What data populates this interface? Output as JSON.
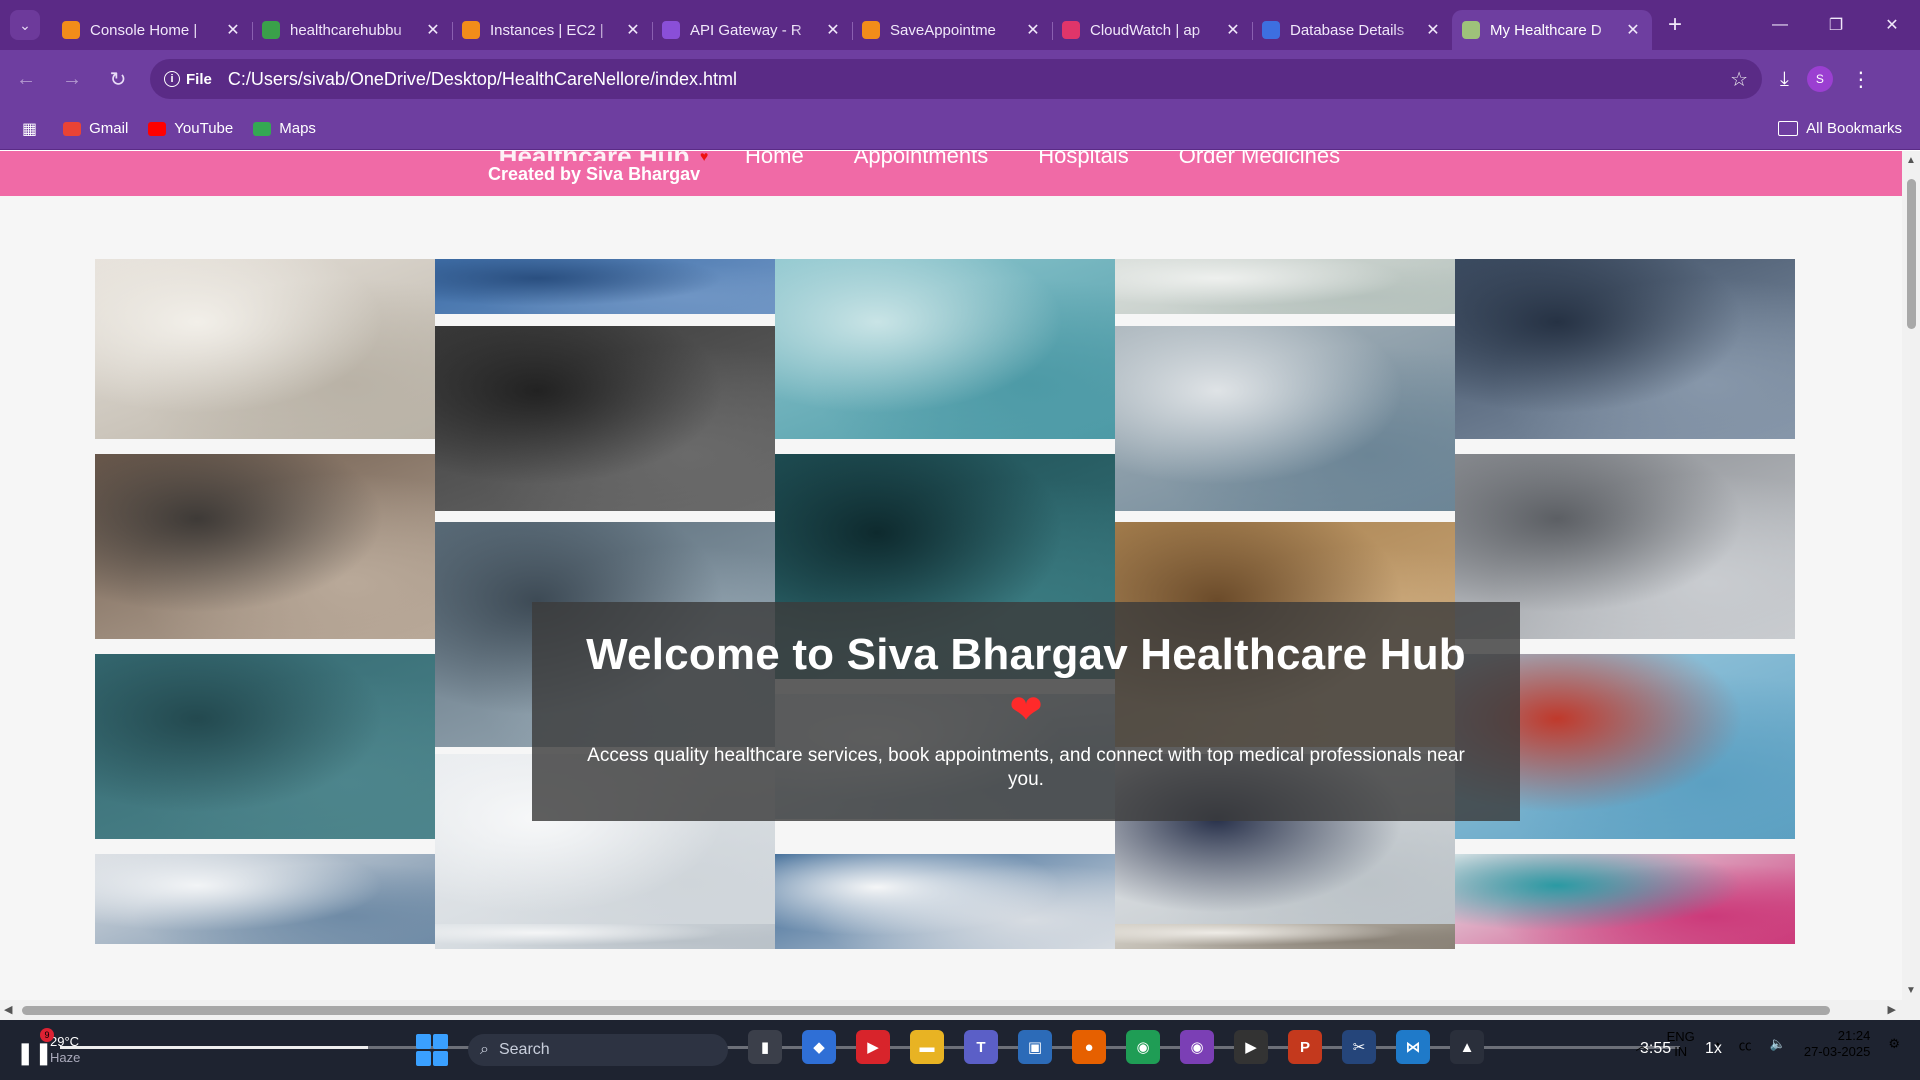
{
  "browser": {
    "tabs": [
      {
        "title": "Console Home |",
        "favicon_color": "#f28c1a",
        "favicon": "cube-icon"
      },
      {
        "title": "healthcarehubbu",
        "favicon_color": "#3aa04a",
        "favicon": "bucket-icon"
      },
      {
        "title": "Instances | EC2 |",
        "favicon_color": "#f28c1a",
        "favicon": "ec2-icon"
      },
      {
        "title": "API Gateway - R",
        "favicon_color": "#8a4fd8",
        "favicon": "api-gateway-icon"
      },
      {
        "title": "SaveAppointme",
        "favicon_color": "#f28c1a",
        "favicon": "lambda-icon"
      },
      {
        "title": "CloudWatch | ap",
        "favicon_color": "#e0356a",
        "favicon": "cloudwatch-icon"
      },
      {
        "title": "Database Details",
        "favicon_color": "#3d6fe0",
        "favicon": "database-icon"
      },
      {
        "title": "My Healthcare D",
        "favicon_color": "#9ec27a",
        "favicon": "globe-icon",
        "active": true
      }
    ],
    "address": {
      "chip": "File",
      "url": "C:/Users/sivab/OneDrive/Desktop/HealthCareNellore/index.html"
    },
    "profile_initial": "S",
    "bookmarks": [
      {
        "label": "Gmail",
        "color": "#ea4335"
      },
      {
        "label": "YouTube",
        "color": "#ff0000"
      },
      {
        "label": "Maps",
        "color": "#34a853"
      }
    ],
    "all_bookmarks": "All Bookmarks"
  },
  "site": {
    "brand_name": "Healthcare Hub",
    "brand_sub": "Created by Siva Bhargav",
    "nav": [
      "Home",
      "Appointments",
      "Hospitals",
      "Order Medicines"
    ],
    "header_color": "#f06aa6",
    "welcome_title": "Welcome to Siva Bhargav Healthcare Hub",
    "welcome_heart": "❤",
    "welcome_text": "Access quality healthcare services, book appointments, and connect with top medical professionals near you."
  },
  "gallery": [
    {
      "name": "hospital-ward-photo",
      "colors": [
        "#e6e1da",
        "#b9b2a6",
        "#f2efe9"
      ]
    },
    {
      "name": "surgeons-top-photo",
      "colors": [
        "#3e6ea8",
        "#6f95c4",
        "#2a4f80"
      ]
    },
    {
      "name": "iv-drip-hand-photo",
      "colors": [
        "#8fc7cf",
        "#4d9aa6",
        "#c9e4e6"
      ]
    },
    {
      "name": "ward-ceiling-photo",
      "colors": [
        "#d8ddd9",
        "#b6c2bd",
        "#eef0ee"
      ]
    },
    {
      "name": "icu-team-photo",
      "colors": [
        "#3d4d63",
        "#8797aa",
        "#263244"
      ]
    },
    {
      "name": "operating-room-bw-photo",
      "colors": [
        "#3b3b3b",
        "#6a6a6a",
        "#222"
      ]
    },
    {
      "name": "doctor-mask-photo",
      "colors": [
        "#a9b4bb",
        "#6c8596",
        "#dfe3e6"
      ]
    },
    {
      "name": "laptop-stethoscope-photo",
      "colors": [
        "#6d5a4c",
        "#b9a999",
        "#3e3a37"
      ]
    },
    {
      "name": "dark-corridor-photo",
      "colors": [
        "#1f4f55",
        "#3a7a80",
        "#0e2a2e"
      ]
    },
    {
      "name": "hospital-hallway-photo",
      "colors": [
        "#8a8d92",
        "#c9ccd0",
        "#5c5f64"
      ]
    },
    {
      "name": "clinic-room-photo",
      "colors": [
        "#5b6d7a",
        "#9cadb9",
        "#3d4a55"
      ]
    },
    {
      "name": "nurse-portrait-photo",
      "colors": [
        "#a8814f",
        "#d4b387",
        "#6b4b2a"
      ]
    },
    {
      "name": "iv-stand-photo",
      "colors": [
        "#356a72",
        "#4d858c",
        "#23494f"
      ]
    },
    {
      "name": "empty-operating-room-photo",
      "colors": [
        "#e9ecef",
        "#cfd5da",
        "#f7f8f9"
      ]
    },
    {
      "name": "dental-clinic-photo",
      "colors": [
        "#dde4ea",
        "#9fb6c4",
        "#f1f4f6"
      ]
    },
    {
      "name": "hospital-bed-room-photo",
      "colors": [
        "#e8eaec",
        "#bcc3c8",
        "#27304a"
      ]
    },
    {
      "name": "patient-arm-iv-photo",
      "colors": [
        "#9cc9de",
        "#5ca0c2",
        "#c0392b"
      ]
    },
    {
      "name": "hospital-queue-photo",
      "colors": [
        "#d9dde2",
        "#6f8ba6",
        "#f2f4f6"
      ]
    },
    {
      "name": "clinic-window-photo",
      "colors": [
        "#2f5f8f",
        "#d7dce2",
        "#f5f6f7"
      ]
    },
    {
      "name": "dental-room-bottom-photo",
      "colors": [
        "#dde2e6",
        "#b9c1c8",
        "#f4f5f6"
      ]
    },
    {
      "name": "ward-floor-photo",
      "colors": [
        "#d3cfc6",
        "#8a8277",
        "#eeebe6"
      ]
    },
    {
      "name": "pills-stethoscope-photo",
      "colors": [
        "#e8eaec",
        "#cc3a7a",
        "#2a9aa3"
      ]
    }
  ],
  "taskbar": {
    "weather_temp": "29°C",
    "weather_desc": "Haze",
    "weather_badge": "9",
    "search_placeholder": "Search",
    "lang_top": "ENG",
    "lang_bottom": "IN",
    "time": "21:24",
    "date": "27-03-2025",
    "media_time": "3:55",
    "media_speed": "1x",
    "media_progress": 0.19
  }
}
